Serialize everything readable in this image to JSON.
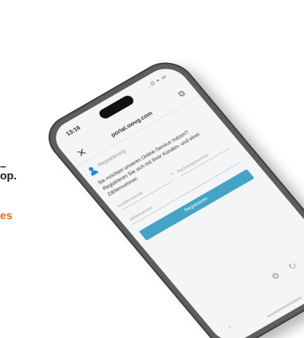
{
  "side_text": {
    "line1": "–",
    "line2": "op.",
    "line3": "es"
  },
  "phone": {
    "status_time": "13:16",
    "status_icons": "..ll ≈ ▭",
    "url": "portal.swvg.com",
    "registration_title": "Registrierung",
    "intro_text": "Sie möchten unseren Online-Service nutzen? Registrieren Sie sich mit Ihrer Kunden- und einer Zählernummer.",
    "fields": {
      "kundennummer_placeholder": "Kundennummer",
      "plus": "+",
      "rechnungsnummer_placeholder": "Rechnungsnummer",
      "zaehlernummer_placeholder": "Zählernummer"
    },
    "register_button": "Registrieren",
    "bottom_icons": "⏻ ↻ ⊘"
  },
  "colors": {
    "accent_orange": "#e46a1e",
    "button_blue": "#45a4c6",
    "icon_blue": "#2f86c9",
    "phone_frame": "#5c5e60"
  }
}
